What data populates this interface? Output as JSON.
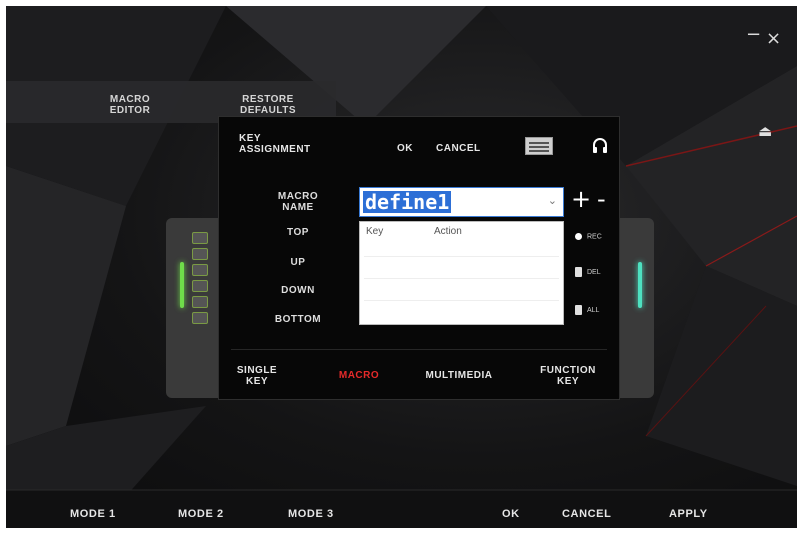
{
  "window": {
    "minimize_glyph": "−",
    "close_glyph": "×",
    "eject_glyph": "⏏"
  },
  "top_buttons": {
    "macro_editor": "MACRO\nEDITOR",
    "restore_defaults": "RESTORE\nDEFAULTS"
  },
  "dialog": {
    "title": "KEY\nASSIGNMENT",
    "ok": "OK",
    "cancel": "CANCEL",
    "icons": [
      "keyboard-icon",
      "headset-icon"
    ],
    "row_labels": {
      "macro_name": "MACRO\nNAME",
      "top": "TOP",
      "up": "UP",
      "down": "DOWN",
      "bottom": "BOTTOM"
    },
    "macro_select": {
      "value": "define1",
      "chevron": "⌄"
    },
    "add": "+",
    "remove": "-",
    "table": {
      "columns": [
        "Key",
        "Action"
      ],
      "rows": []
    },
    "side_buttons": {
      "rec": "REC",
      "del": "DEL",
      "all": "ALL"
    },
    "tabs": [
      {
        "label": "SINGLE\nKEY",
        "active": false
      },
      {
        "label": "MACRO",
        "active": true
      },
      {
        "label": "MULTIMEDIA",
        "active": false
      },
      {
        "label": "FUNCTION\nKEY",
        "active": false
      }
    ],
    "active_tab_color": "#e52a2a"
  },
  "bottom_bar": {
    "mode1": "MODE 1",
    "mode2": "MODE 2",
    "mode3": "MODE 3",
    "ok": "OK",
    "cancel": "CANCEL",
    "apply": "APPLY"
  }
}
